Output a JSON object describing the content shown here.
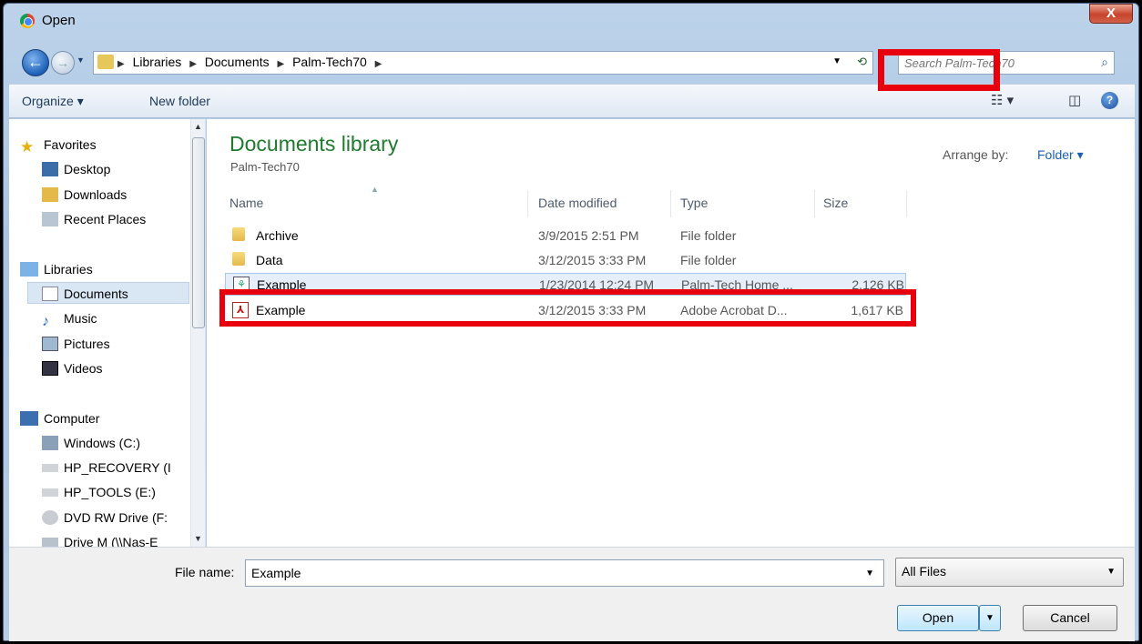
{
  "window": {
    "title": "Open",
    "close_symbol": "X"
  },
  "address": {
    "crumbs": [
      "Libraries",
      "Documents",
      "Palm-Tech70"
    ],
    "search_placeholder": "Search Palm-Tech70"
  },
  "toolbar": {
    "organize": "Organize ▾",
    "new_folder": "New folder",
    "help": "?"
  },
  "nav": {
    "favorites": "Favorites",
    "desktop": "Desktop",
    "downloads": "Downloads",
    "recent": "Recent Places",
    "libraries": "Libraries",
    "documents": "Documents",
    "music": "Music",
    "pictures": "Pictures",
    "videos": "Videos",
    "computer": "Computer",
    "windows_c": "Windows (C:)",
    "hp_recovery": "HP_RECOVERY (I",
    "hp_tools": "HP_TOOLS (E:)",
    "dvd": "DVD RW Drive (F:",
    "drive_m": "Drive M (\\\\Nas-E"
  },
  "content": {
    "library_title": "Documents library",
    "library_subtitle": "Palm-Tech70",
    "arrange_label": "Arrange by:",
    "arrange_value": "Folder ▾",
    "columns": {
      "name": "Name",
      "date": "Date modified",
      "type": "Type",
      "size": "Size"
    },
    "files": [
      {
        "name": "Archive",
        "date": "3/9/2015 2:51 PM",
        "type": "File folder",
        "size": "",
        "icon": "folder-icon"
      },
      {
        "name": "Data",
        "date": "3/12/2015 3:33 PM",
        "type": "File folder",
        "size": "",
        "icon": "folder-icon"
      },
      {
        "name": "Example",
        "date": "1/23/2014 12:24 PM",
        "type": "Palm-Tech Home ...",
        "size": "2,126 KB",
        "icon": "palm-tech-file-icon"
      },
      {
        "name": "Example",
        "date": "3/12/2015 3:33 PM",
        "type": "Adobe Acrobat D...",
        "size": "1,617 KB",
        "icon": "pdf-icon"
      }
    ]
  },
  "bottom": {
    "file_name_label": "File name:",
    "file_name_value": "Example",
    "filter_value": "All Files",
    "open_label": "Open",
    "cancel_label": "Cancel"
  },
  "colors": {
    "highlight": "#e8000f",
    "library_title": "#1e7b2d",
    "link": "#1b5fb4"
  }
}
